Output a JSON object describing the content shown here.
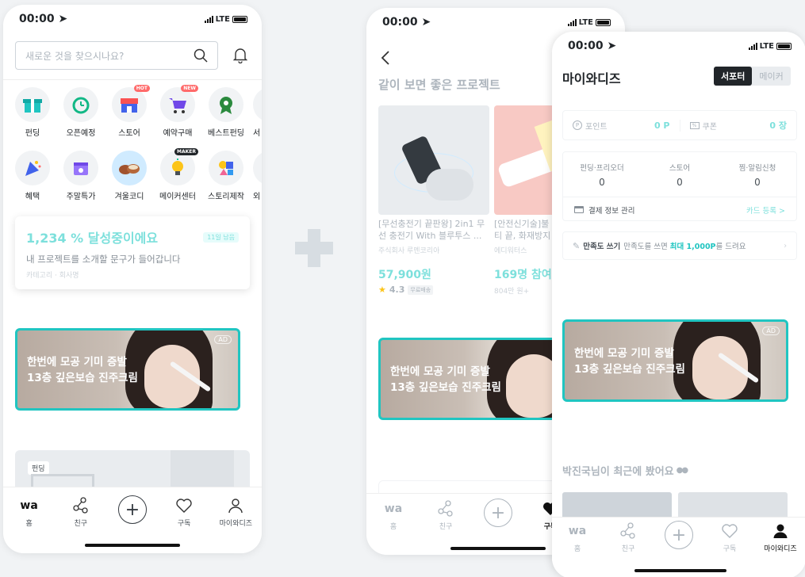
{
  "colors": {
    "accent": "#20c5c1",
    "primary": "#00c4c4",
    "hot": "#ff5a5a"
  },
  "status": {
    "time": "00:00",
    "network": "LTE"
  },
  "screen1": {
    "search_placeholder": "새로운 것을 찾으시나요?",
    "categories_row1": [
      {
        "label": "펀딩",
        "icon": "gift-icon"
      },
      {
        "label": "오픈예정",
        "icon": "alarm-clock-icon"
      },
      {
        "label": "스토어",
        "icon": "store-icon",
        "badge": "HOT"
      },
      {
        "label": "예약구매",
        "icon": "cart-icon",
        "badge": "NEW"
      },
      {
        "label": "베스트펀딩",
        "icon": "medal-icon"
      },
      {
        "label": "서",
        "icon": "partial-icon"
      }
    ],
    "categories_row2": [
      {
        "label": "혜택",
        "icon": "party-icon"
      },
      {
        "label": "주말특가",
        "icon": "calendar-icon"
      },
      {
        "label": "겨울코디",
        "icon": "slippers-icon"
      },
      {
        "label": "메이커센터",
        "icon": "bulb-icon",
        "badge": "MAKER"
      },
      {
        "label": "스토리제작",
        "icon": "shapes-icon"
      },
      {
        "label": "외",
        "icon": "partial-icon"
      }
    ],
    "promo": {
      "headline": "1,234 % 달성중이에요",
      "days_left": "11일 남음",
      "desc": "내 프로젝트를 소개할 문구가 들어갑니다",
      "meta": "카테고리 · 회사명"
    },
    "banner": {
      "line1": "한번에 모공 기미 증발",
      "line2": "13층 깊은보습 진주크림",
      "tag": "AD"
    },
    "card_tag": "펀딩",
    "tabs": [
      "홈",
      "친구",
      "",
      "구독",
      "마이와디즈"
    ],
    "logo": "wa"
  },
  "screen2": {
    "section_title": "같이 보면 좋은 프로젝트",
    "products": [
      {
        "title": "[무선충전기 끝판왕] 2in1 무선 충전기 With 블루투스 ...",
        "maker": "주식회사 루멘코리아",
        "price": "57,900원",
        "rating": "4.3",
        "shipping": "무료배송"
      },
      {
        "title": "[안전신기술]불티 끝, 화재방지스탠",
        "maker": "에디워터스",
        "price": "169명 참여",
        "sub": "804만 원+"
      }
    ],
    "banner": {
      "line1": "한번에 모공 기미 증발",
      "line2": "13층 깊은보습 진주크림"
    },
    "tabs": [
      "홈",
      "친구",
      "",
      "구독"
    ],
    "logo": "wa"
  },
  "screen3": {
    "title": "마이와디즈",
    "toggle": [
      "서포터",
      "메이커"
    ],
    "point_label": "포인트",
    "point_value": "0 P",
    "coupon_label": "쿠폰",
    "coupon_value": "0 장",
    "stats": [
      {
        "label": "펀딩·프리오더",
        "value": "0"
      },
      {
        "label": "스토어",
        "value": "0"
      },
      {
        "label": "찜·알림신청",
        "value": "0"
      }
    ],
    "payment_label": "결제 정보 관리",
    "card_register": "카드 등록 >",
    "review_bold": "만족도 쓰기",
    "review_pre": "만족도를 쓰면 ",
    "review_hl": "최대 1,000P",
    "review_post": "를 드려요",
    "banner": {
      "line1": "한번에 모공 기미 증발",
      "line2": "13층 깊은보습 진주크림",
      "tag": "AD"
    },
    "recent_title": "박진국님이 최근에 봤어요",
    "tabs": [
      "홈",
      "친구",
      "",
      "구독",
      "마이와디즈"
    ],
    "logo": "wa"
  }
}
